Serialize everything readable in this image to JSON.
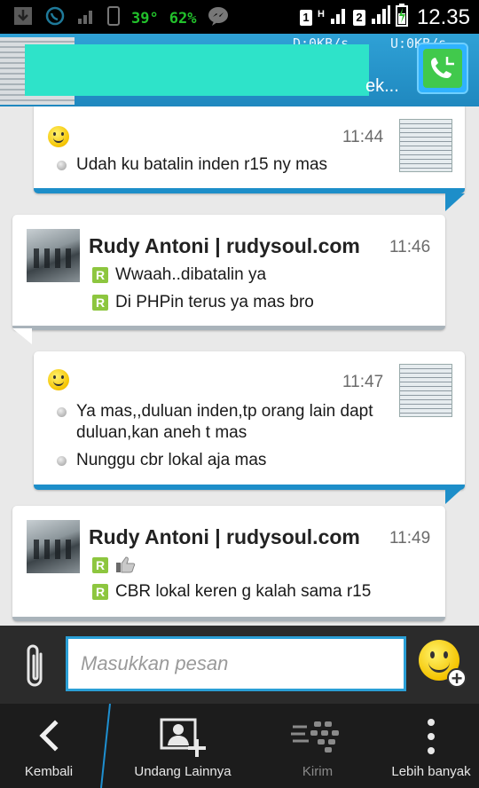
{
  "status_bar": {
    "temperature": "39°",
    "battery_percent": "62%",
    "sim1": "1",
    "sim2": "2",
    "network_type": "H",
    "time": "12.35"
  },
  "header": {
    "download_rate": "D:0KB/s",
    "upload_rate": "U:0KB/s",
    "title_visible_fragment": "ek..."
  },
  "messages": [
    {
      "direction": "outgoing",
      "time": "11:44",
      "lines": [
        "Udah ku batalin inden r15 ny mas"
      ]
    },
    {
      "direction": "incoming",
      "sender": "Rudy Antoni | rudysoul.com",
      "time": "11:46",
      "lines": [
        "Wwaah..dibatalin ya",
        "Di PHPin terus ya mas bro"
      ]
    },
    {
      "direction": "outgoing",
      "time": "11:47",
      "lines": [
        "Ya mas,,duluan inden,tp orang lain dapt duluan,kan aneh t mas",
        "Nunggu cbr lokal aja mas"
      ]
    },
    {
      "direction": "incoming",
      "sender": "Rudy Antoni | rudysoul.com",
      "time": "11:49",
      "lines": [
        "CBR lokal keren g kalah sama r15"
      ]
    }
  ],
  "read_badge": "R",
  "composer": {
    "placeholder": "Masukkan pesan"
  },
  "nav": {
    "back": "Kembali",
    "invite": "Undang Lainnya",
    "send": "Kirim",
    "more": "Lebih banyak"
  },
  "colors": {
    "accent": "#1d8ec9",
    "read_badge": "#8dc63f",
    "header_bg": "#2fa1d6",
    "status_green": "#22c12b"
  }
}
